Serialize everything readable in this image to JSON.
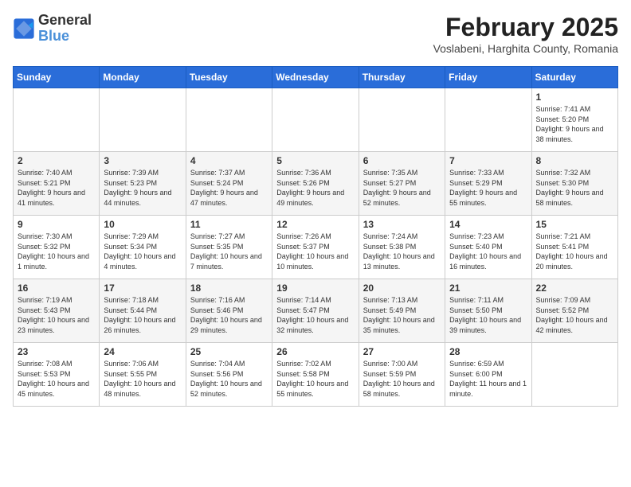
{
  "logo": {
    "line1": "General",
    "line2": "Blue"
  },
  "title": {
    "month_year": "February 2025",
    "location": "Voslabeni, Harghita County, Romania"
  },
  "headers": [
    "Sunday",
    "Monday",
    "Tuesday",
    "Wednesday",
    "Thursday",
    "Friday",
    "Saturday"
  ],
  "weeks": [
    [
      {
        "day": "",
        "info": ""
      },
      {
        "day": "",
        "info": ""
      },
      {
        "day": "",
        "info": ""
      },
      {
        "day": "",
        "info": ""
      },
      {
        "day": "",
        "info": ""
      },
      {
        "day": "",
        "info": ""
      },
      {
        "day": "1",
        "info": "Sunrise: 7:41 AM\nSunset: 5:20 PM\nDaylight: 9 hours and 38 minutes."
      }
    ],
    [
      {
        "day": "2",
        "info": "Sunrise: 7:40 AM\nSunset: 5:21 PM\nDaylight: 9 hours and 41 minutes."
      },
      {
        "day": "3",
        "info": "Sunrise: 7:39 AM\nSunset: 5:23 PM\nDaylight: 9 hours and 44 minutes."
      },
      {
        "day": "4",
        "info": "Sunrise: 7:37 AM\nSunset: 5:24 PM\nDaylight: 9 hours and 47 minutes."
      },
      {
        "day": "5",
        "info": "Sunrise: 7:36 AM\nSunset: 5:26 PM\nDaylight: 9 hours and 49 minutes."
      },
      {
        "day": "6",
        "info": "Sunrise: 7:35 AM\nSunset: 5:27 PM\nDaylight: 9 hours and 52 minutes."
      },
      {
        "day": "7",
        "info": "Sunrise: 7:33 AM\nSunset: 5:29 PM\nDaylight: 9 hours and 55 minutes."
      },
      {
        "day": "8",
        "info": "Sunrise: 7:32 AM\nSunset: 5:30 PM\nDaylight: 9 hours and 58 minutes."
      }
    ],
    [
      {
        "day": "9",
        "info": "Sunrise: 7:30 AM\nSunset: 5:32 PM\nDaylight: 10 hours and 1 minute."
      },
      {
        "day": "10",
        "info": "Sunrise: 7:29 AM\nSunset: 5:34 PM\nDaylight: 10 hours and 4 minutes."
      },
      {
        "day": "11",
        "info": "Sunrise: 7:27 AM\nSunset: 5:35 PM\nDaylight: 10 hours and 7 minutes."
      },
      {
        "day": "12",
        "info": "Sunrise: 7:26 AM\nSunset: 5:37 PM\nDaylight: 10 hours and 10 minutes."
      },
      {
        "day": "13",
        "info": "Sunrise: 7:24 AM\nSunset: 5:38 PM\nDaylight: 10 hours and 13 minutes."
      },
      {
        "day": "14",
        "info": "Sunrise: 7:23 AM\nSunset: 5:40 PM\nDaylight: 10 hours and 16 minutes."
      },
      {
        "day": "15",
        "info": "Sunrise: 7:21 AM\nSunset: 5:41 PM\nDaylight: 10 hours and 20 minutes."
      }
    ],
    [
      {
        "day": "16",
        "info": "Sunrise: 7:19 AM\nSunset: 5:43 PM\nDaylight: 10 hours and 23 minutes."
      },
      {
        "day": "17",
        "info": "Sunrise: 7:18 AM\nSunset: 5:44 PM\nDaylight: 10 hours and 26 minutes."
      },
      {
        "day": "18",
        "info": "Sunrise: 7:16 AM\nSunset: 5:46 PM\nDaylight: 10 hours and 29 minutes."
      },
      {
        "day": "19",
        "info": "Sunrise: 7:14 AM\nSunset: 5:47 PM\nDaylight: 10 hours and 32 minutes."
      },
      {
        "day": "20",
        "info": "Sunrise: 7:13 AM\nSunset: 5:49 PM\nDaylight: 10 hours and 35 minutes."
      },
      {
        "day": "21",
        "info": "Sunrise: 7:11 AM\nSunset: 5:50 PM\nDaylight: 10 hours and 39 minutes."
      },
      {
        "day": "22",
        "info": "Sunrise: 7:09 AM\nSunset: 5:52 PM\nDaylight: 10 hours and 42 minutes."
      }
    ],
    [
      {
        "day": "23",
        "info": "Sunrise: 7:08 AM\nSunset: 5:53 PM\nDaylight: 10 hours and 45 minutes."
      },
      {
        "day": "24",
        "info": "Sunrise: 7:06 AM\nSunset: 5:55 PM\nDaylight: 10 hours and 48 minutes."
      },
      {
        "day": "25",
        "info": "Sunrise: 7:04 AM\nSunset: 5:56 PM\nDaylight: 10 hours and 52 minutes."
      },
      {
        "day": "26",
        "info": "Sunrise: 7:02 AM\nSunset: 5:58 PM\nDaylight: 10 hours and 55 minutes."
      },
      {
        "day": "27",
        "info": "Sunrise: 7:00 AM\nSunset: 5:59 PM\nDaylight: 10 hours and 58 minutes."
      },
      {
        "day": "28",
        "info": "Sunrise: 6:59 AM\nSunset: 6:00 PM\nDaylight: 11 hours and 1 minute."
      },
      {
        "day": "",
        "info": ""
      }
    ]
  ]
}
